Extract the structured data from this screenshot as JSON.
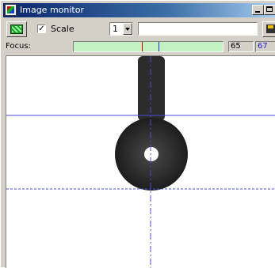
{
  "window": {
    "title": "Image monitor"
  },
  "toolbar": {
    "scale_checked": true,
    "scale_check_mark": "✓",
    "scale_label": "Scale",
    "scale_value": "1",
    "text_value": ""
  },
  "focus": {
    "label": "Focus:",
    "value_1": "65",
    "value_2": "67",
    "bar_color": "#c2f2c2"
  },
  "icons": [
    "app-icon",
    "minimize-icon",
    "maximize-icon",
    "close-icon",
    "image-tool-icon",
    "chevron-down-icon",
    "save-disk-icon"
  ],
  "colors": {
    "crosshair": "#4a4ad8",
    "object_dark": "#2b2b2b",
    "marker_red": "#d40000",
    "marker_blue": "#2a2ae0"
  }
}
